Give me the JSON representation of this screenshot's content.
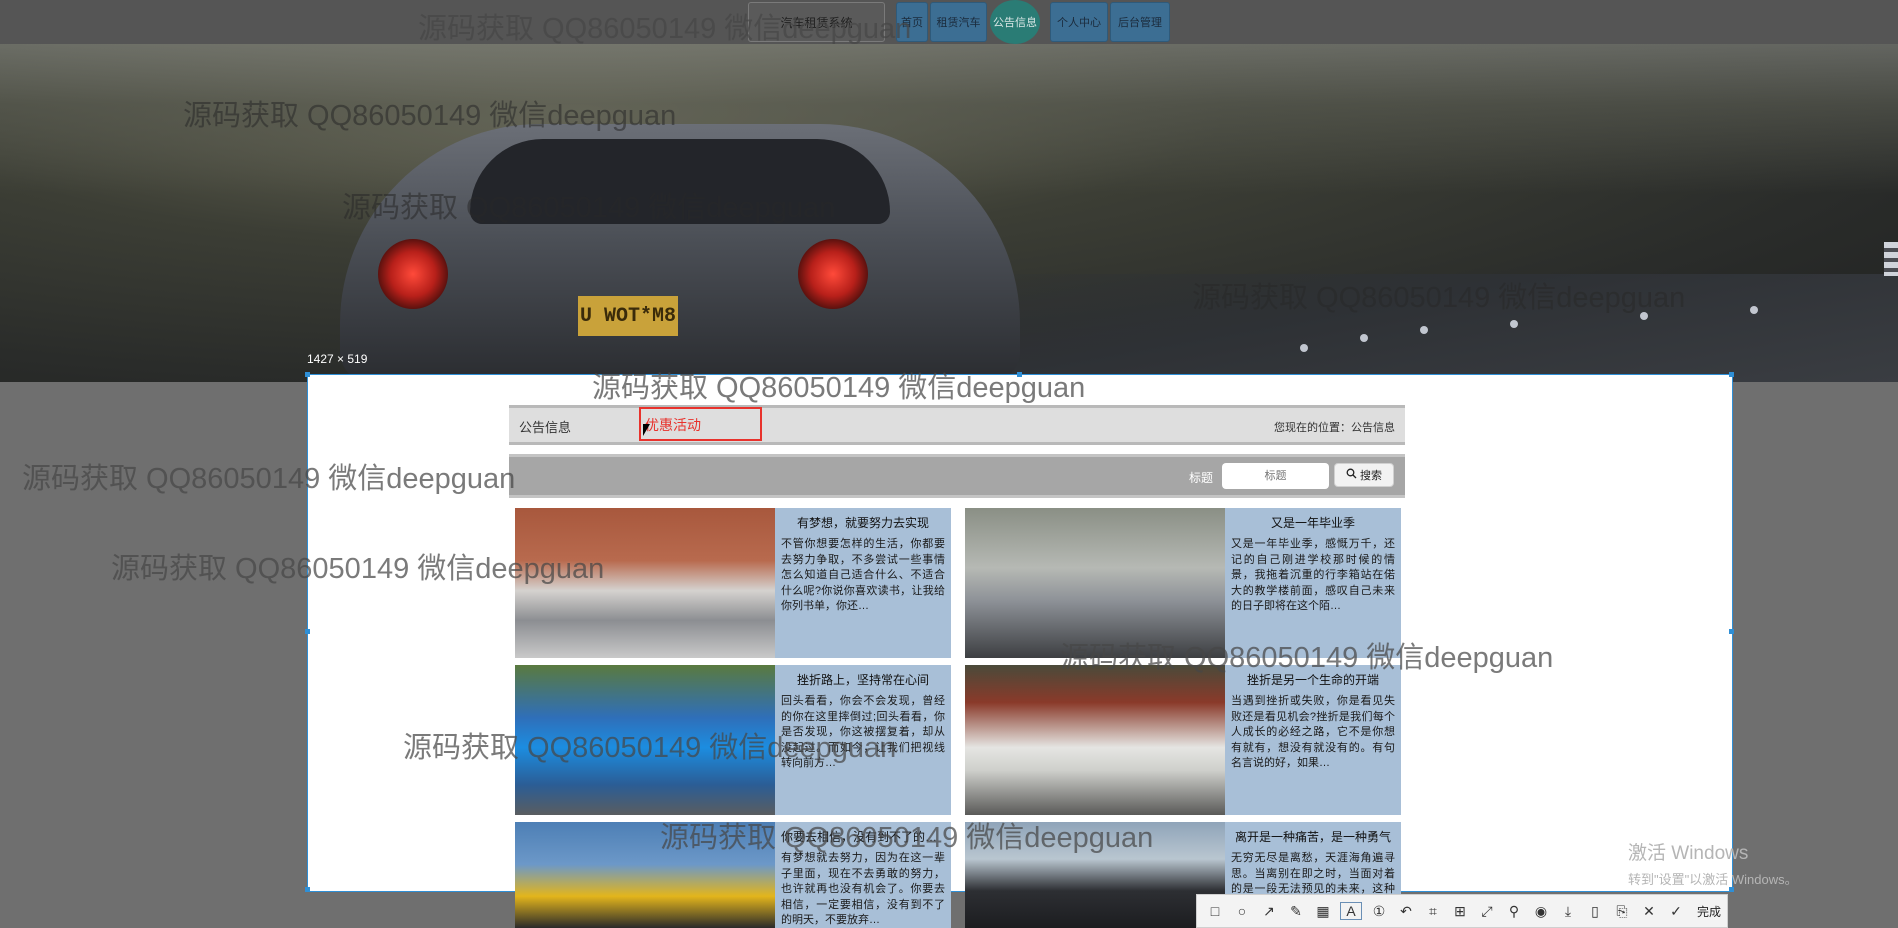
{
  "nav": {
    "site_title": "汽车租赁系统",
    "items": [
      "首页",
      "租赁汽车",
      "公告信息",
      "个人中心",
      "后台管理"
    ]
  },
  "banner": {
    "plate": "U WOT*M8"
  },
  "screenshot_tool": {
    "size_label": "1427 × 519",
    "done_label": "完成"
  },
  "breadcrumb": {
    "title": "公告信息",
    "typed_text": "优惠活动",
    "location": "您现在的位置：公告信息"
  },
  "search": {
    "label": "标题",
    "placeholder": "标题",
    "button": "搜索"
  },
  "cards": [
    {
      "title": "有梦想，就要努力去实现",
      "body": "不管你想要怎样的生活，你都要去努力争取，不多尝试一些事情怎么知道自己适合什么、不适合什么呢?你说你喜欢读书，让我给你列书单，你还…"
    },
    {
      "title": "又是一年毕业季",
      "body": "又是一年毕业季，感慨万千，还记的自己刚进学校那时候的情景，我拖着沉重的行李箱站在偌大的教学楼前面，感叹自己未来的日子即将在这个陌…"
    },
    {
      "title": "挫折路上，坚持常在心间",
      "body": "回头看看，你会不会发现，曾经的你在这里摔倒过;回头看看，你是否发现，你这被摆复着，却从没起过。而如今，让我们把视线转向前方…"
    },
    {
      "title": "挫折是另一个生命的开端",
      "body": "当遇到挫折或失败，你是看见失败还是看见机会?挫折是我们每个人成长的必经之路，它不是你想有就有，想没有就没有的。有句名言说的好，如果…"
    },
    {
      "title": "你要去相信，没有到不了的明天",
      "body": "有梦想就去努力，因为在这一辈子里面，现在不去勇敢的努力，也许就再也没有机会了。你要去相信，一定要相信，没有到不了的明天，不要放弃…"
    },
    {
      "title": "离开是一种痛苦，是一种勇气",
      "body": "无穷无尽是离愁，天涯海角遍寻思。当离别在即之时，当面对着的是一段无法预见的未来，这种离别，是一种痛苦…"
    }
  ],
  "watermark": "源码获取 QQ86050149 微信deepguan",
  "os_notice": {
    "line1": "激活 Windows",
    "line2": "转到\"设置\"以激活 Windows。"
  }
}
